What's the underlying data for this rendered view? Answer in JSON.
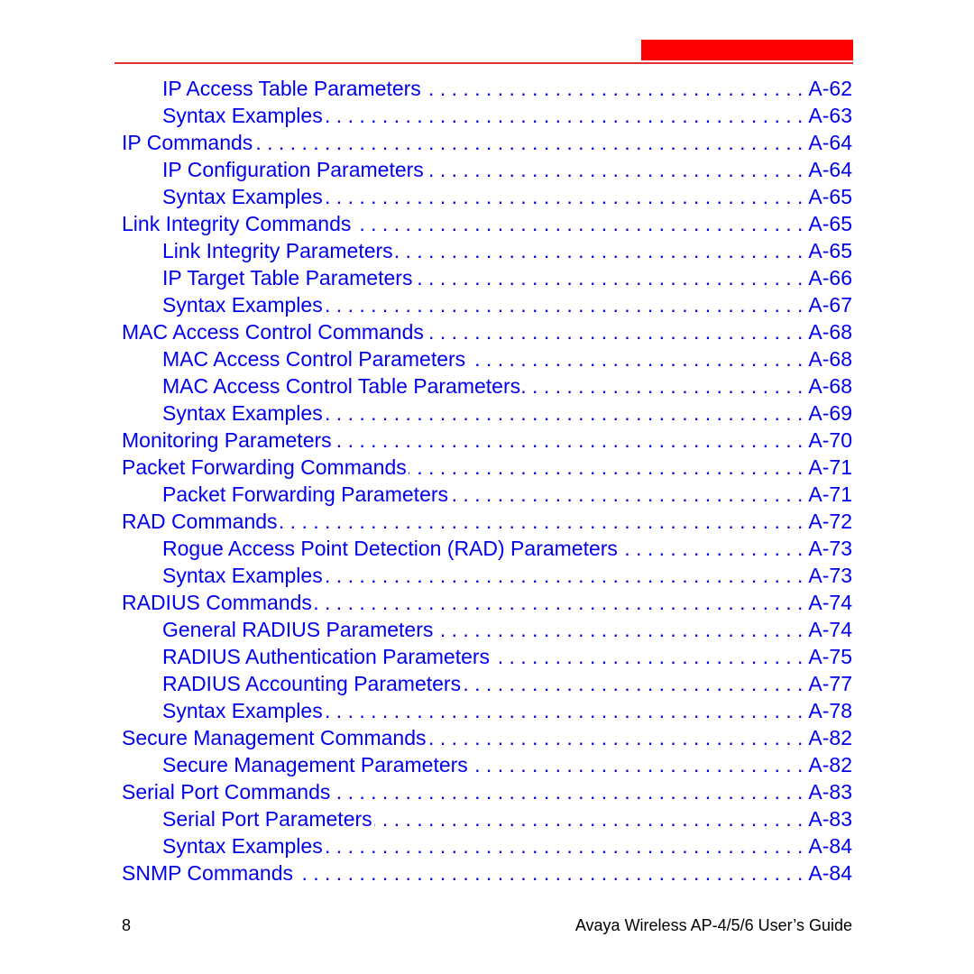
{
  "colors": {
    "link": "#0000ee",
    "accent": "#ff0000"
  },
  "toc": [
    {
      "level": 2,
      "title": "IP Access Table Parameters",
      "page": "A-62"
    },
    {
      "level": 2,
      "title": "Syntax Examples",
      "page": "A-63"
    },
    {
      "level": 1,
      "title": "IP Commands",
      "page": "A-64"
    },
    {
      "level": 2,
      "title": "IP Configuration Parameters",
      "page": "A-64"
    },
    {
      "level": 2,
      "title": "Syntax Examples",
      "page": "A-65"
    },
    {
      "level": 1,
      "title": "Link Integrity Commands",
      "page": "A-65"
    },
    {
      "level": 2,
      "title": "Link Integrity Parameters",
      "page": "A-65"
    },
    {
      "level": 2,
      "title": "IP Target Table Parameters",
      "page": "A-66"
    },
    {
      "level": 2,
      "title": "Syntax Examples",
      "page": "A-67"
    },
    {
      "level": 1,
      "title": "MAC Access Control Commands",
      "page": "A-68"
    },
    {
      "level": 2,
      "title": "MAC Access Control Parameters",
      "page": "A-68"
    },
    {
      "level": 2,
      "title": "MAC Access Control Table Parameters",
      "page": "A-68"
    },
    {
      "level": 2,
      "title": "Syntax Examples",
      "page": "A-69"
    },
    {
      "level": 1,
      "title": "Monitoring Parameters",
      "page": "A-70"
    },
    {
      "level": 1,
      "title": "Packet Forwarding Commands",
      "page": "A-71"
    },
    {
      "level": 2,
      "title": "Packet Forwarding Parameters",
      "page": "A-71"
    },
    {
      "level": 1,
      "title": "RAD Commands",
      "page": "A-72"
    },
    {
      "level": 2,
      "title": "Rogue Access Point Detection (RAD) Parameters",
      "page": "A-73"
    },
    {
      "level": 2,
      "title": "Syntax Examples",
      "page": "A-73"
    },
    {
      "level": 1,
      "title": "RADIUS Commands",
      "page": "A-74"
    },
    {
      "level": 2,
      "title": "General RADIUS Parameters",
      "page": "A-74"
    },
    {
      "level": 2,
      "title": "RADIUS Authentication Parameters",
      "page": "A-75"
    },
    {
      "level": 2,
      "title": "RADIUS Accounting Parameters",
      "page": "A-77"
    },
    {
      "level": 2,
      "title": "Syntax Examples",
      "page": "A-78"
    },
    {
      "level": 1,
      "title": "Secure Management Commands",
      "page": "A-82"
    },
    {
      "level": 2,
      "title": "Secure Management Parameters",
      "page": "A-82"
    },
    {
      "level": 1,
      "title": "Serial Port Commands",
      "page": "A-83"
    },
    {
      "level": 2,
      "title": "Serial Port Parameters",
      "page": "A-83"
    },
    {
      "level": 2,
      "title": "Syntax Examples",
      "page": "A-84"
    },
    {
      "level": 1,
      "title": "SNMP Commands",
      "page": "A-84"
    }
  ],
  "footer": {
    "page_number": "8",
    "book_title": "Avaya Wireless AP-4/5/6 User’s Guide"
  }
}
